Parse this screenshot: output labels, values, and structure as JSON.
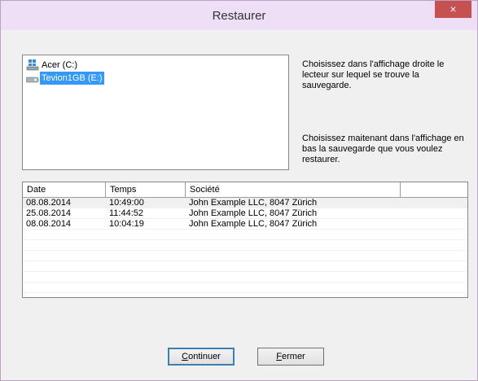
{
  "window": {
    "title": "Restaurer",
    "close_glyph": "×"
  },
  "drives": [
    {
      "label": "Acer (C:)",
      "icon": "windows-drive-icon",
      "selected": false
    },
    {
      "label": "Tevion1GB (E:)",
      "icon": "usb-drive-icon",
      "selected": true
    }
  ],
  "instructions": {
    "top": "Choisissez dans l'affichage droite le lecteur sur lequel se trouve la sauvegarde.",
    "bottom": "Choisissez maitenant dans l'affichage en bas la sauvegarde que vous voulez restaurer."
  },
  "table": {
    "columns": [
      "Date",
      "Temps",
      "Société",
      ""
    ],
    "rows": [
      [
        "08.08.2014",
        "10:49:00",
        "John Example LLC, 8047 Zürich"
      ],
      [
        "25.08.2014",
        "11:44:52",
        "John Example LLC, 8047 Zürich"
      ],
      [
        "08.08.2014",
        "10:04:19",
        "John Example LLC, 8047 Zürich"
      ]
    ]
  },
  "buttons": {
    "continue_mnemonic": "C",
    "continue_rest": "ontinuer",
    "close_mnemonic": "F",
    "close_rest": "ermer"
  },
  "colors": {
    "selection": "#3399ff",
    "titlebar": "#eedff6",
    "close": "#c75050"
  }
}
